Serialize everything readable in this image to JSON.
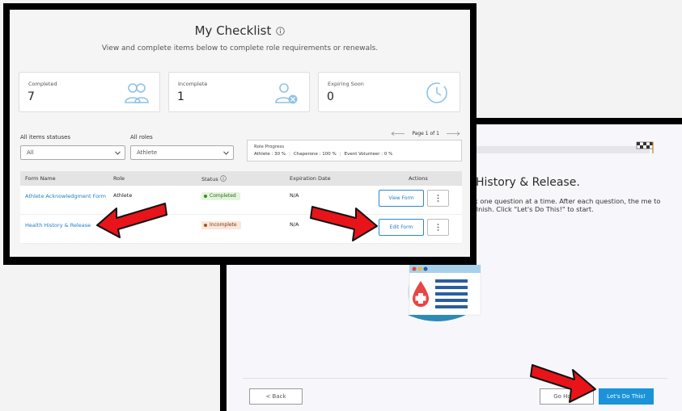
{
  "checklist": {
    "title": "My Checklist",
    "subtitle": "View and complete items below to complete role requirements or renewals.",
    "stats": [
      {
        "label": "Completed",
        "value": "7",
        "icon": "users-icon"
      },
      {
        "label": "Incomplete",
        "value": "1",
        "icon": "user-remove-icon"
      },
      {
        "label": "Expiring Soon",
        "value": "0",
        "icon": "clock-icon"
      }
    ],
    "filters": {
      "statuses_label": "All items statuses",
      "statuses_value": "All",
      "roles_label": "All roles",
      "roles_value": "Athlete"
    },
    "pager": {
      "text": "Page 1 of 1"
    },
    "role_progress": {
      "title": "Role Progress",
      "items": [
        "Athlete : 30 %",
        "Chaperone : 100 %",
        "Event Volunteer : 0 %"
      ]
    },
    "table": {
      "headers": {
        "form_name": "Form Name",
        "role": "Role",
        "status": "Status",
        "expiration": "Expiration Date",
        "actions": "Actions"
      },
      "rows": [
        {
          "form_name": "Athlete Acknowledgment Form",
          "role": "Athlete",
          "status": "Completed",
          "expiration": "N/A",
          "action": "View Form"
        },
        {
          "form_name": "Health History & Release",
          "role": "Athlete",
          "status": "Incomplete",
          "expiration": "N/A",
          "action": "Edit Form"
        }
      ]
    }
  },
  "form_start": {
    "heading": "History & Release.",
    "intro": "k one question at a time. After each question, the me to finish. Click \"Let's Do This!\" to start.",
    "buttons": {
      "back": "< Back",
      "go_home": "Go Home",
      "start": "Let's Do This!"
    }
  },
  "colors": {
    "accent": "#1a93d9",
    "link": "#1d7ec4",
    "annotation_arrow": "#e8141a",
    "completed": "#3c8a28",
    "incomplete": "#a8531f"
  }
}
